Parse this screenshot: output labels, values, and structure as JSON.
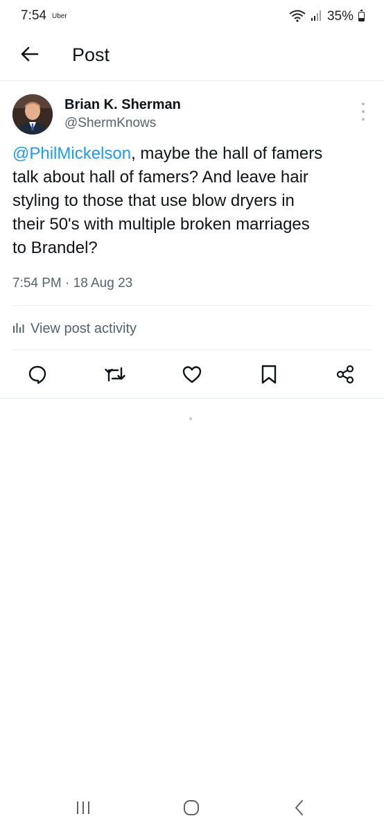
{
  "status_bar": {
    "time": "7:54",
    "app": "Uber",
    "battery_percent": "35%",
    "battery_level": 0.35
  },
  "header": {
    "title": "Post"
  },
  "post": {
    "author_name": "Brian K. Sherman",
    "author_handle": "@ShermKnows",
    "mention": "@PhilMickelson",
    "text_line1_rest": ", maybe the hall of famers",
    "text_line2": "talk about hall of famers? And leave hair",
    "text_line3": "styling to those that use blow dryers in",
    "text_line4": "their 50's with multiple broken marriages",
    "text_line5": "to Brandel?",
    "timestamp": "7:54 PM · 18 Aug 23",
    "view_activity_label": "View post activity"
  },
  "actions": [
    "reply-icon",
    "repost-icon",
    "like-icon",
    "bookmark-icon",
    "share-icon"
  ],
  "colors": {
    "accent": "#1d9bf0",
    "text_primary": "#0f1419",
    "text_secondary": "#536471",
    "divider": "#e6ecf0"
  }
}
